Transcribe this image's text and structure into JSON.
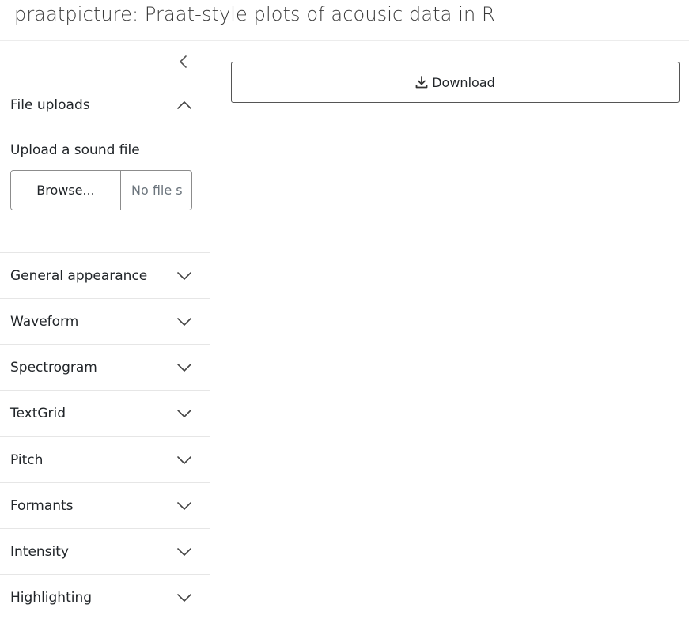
{
  "app": {
    "title": "praatpicture: Praat-style plots of acousic data in R"
  },
  "sidebar": {
    "collapse_icon": "chevron-left-icon",
    "file_uploads": {
      "header": "File uploads",
      "expanded": true,
      "upload_label": "Upload a sound file",
      "browse_label": "Browse...",
      "file_placeholder": "No file s"
    },
    "sections": [
      {
        "label": "General appearance",
        "expanded": false
      },
      {
        "label": "Waveform",
        "expanded": false
      },
      {
        "label": "Spectrogram",
        "expanded": false
      },
      {
        "label": "TextGrid",
        "expanded": false
      },
      {
        "label": "Pitch",
        "expanded": false
      },
      {
        "label": "Formants",
        "expanded": false
      },
      {
        "label": "Intensity",
        "expanded": false
      },
      {
        "label": "Highlighting",
        "expanded": false
      }
    ]
  },
  "main": {
    "download_label": "Download",
    "download_icon": "download-icon"
  }
}
